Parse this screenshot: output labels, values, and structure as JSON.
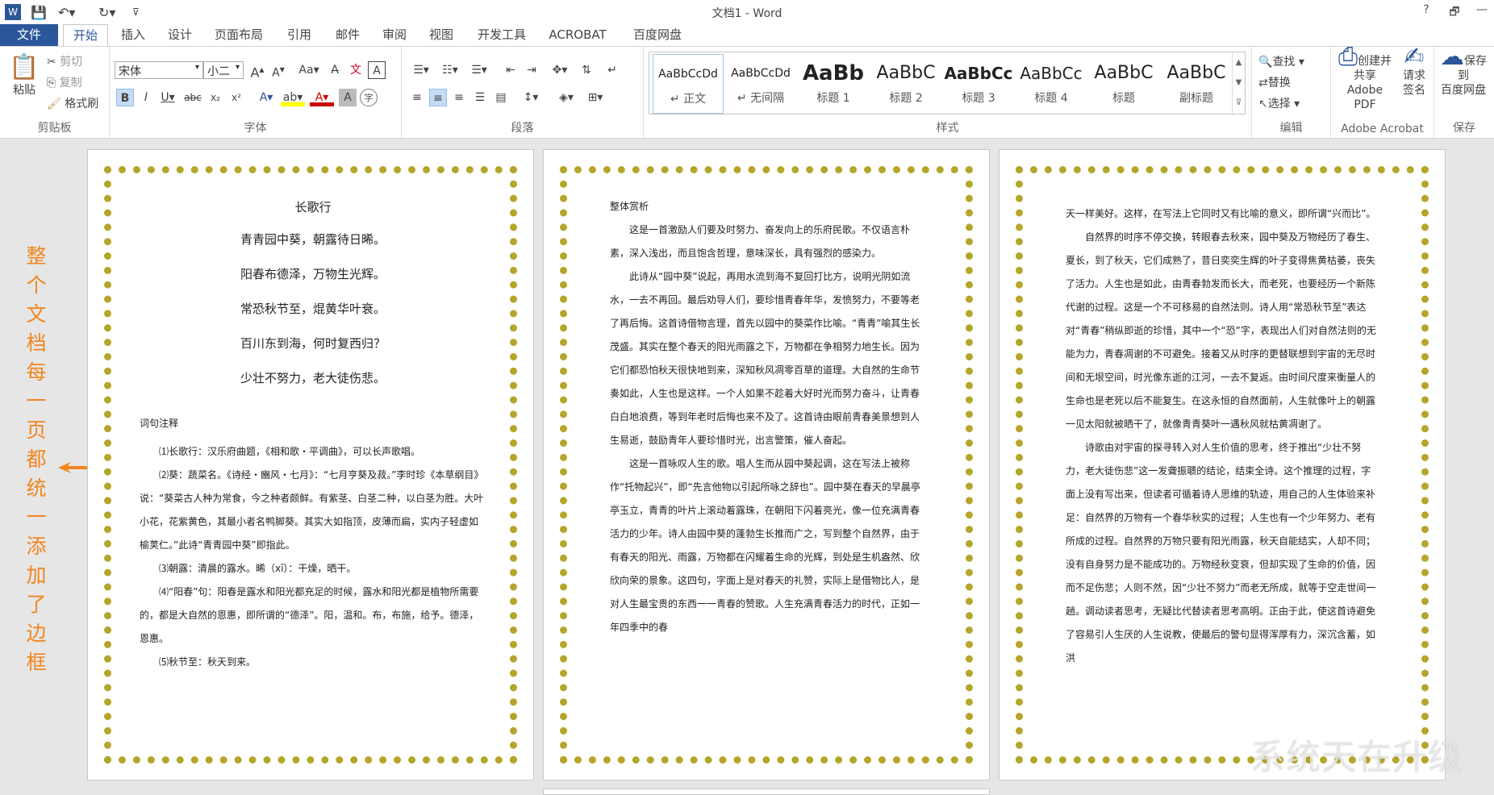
{
  "window": {
    "title": "文档1 - Word",
    "help": "?",
    "restore": "🗗",
    "minimize": "—"
  },
  "tabs": {
    "file": "文件",
    "items": [
      "开始",
      "插入",
      "设计",
      "页面布局",
      "引用",
      "邮件",
      "审阅",
      "视图",
      "开发工具",
      "ACROBAT",
      "百度网盘"
    ]
  },
  "ribbon": {
    "clipboard": {
      "label": "剪贴板",
      "paste": "粘贴",
      "cut": "剪切",
      "copy": "复制",
      "format_painter": "格式刷"
    },
    "font": {
      "label": "字体",
      "name": "宋体",
      "size": "小二"
    },
    "paragraph": {
      "label": "段落"
    },
    "styles": {
      "label": "样式",
      "items": [
        {
          "preview": "AaBbCcDd",
          "name": "↵ 正文"
        },
        {
          "preview": "AaBbCcDd",
          "name": "↵ 无间隔"
        },
        {
          "preview": "AaBb",
          "name": "标题 1"
        },
        {
          "preview": "AaBbC",
          "name": "标题 2"
        },
        {
          "preview": "AaBbCc",
          "name": "标题 3"
        },
        {
          "preview": "AaBbCc",
          "name": "标题 4"
        },
        {
          "preview": "AaBbC",
          "name": "标题"
        },
        {
          "preview": "AaBbC",
          "name": "副标题"
        }
      ]
    },
    "editing": {
      "label": "编辑",
      "find": "查找",
      "replace": "替换",
      "select": "选择"
    },
    "acrobat": {
      "label": "Adobe Acrobat",
      "create": "创建并共享\nAdobe PDF",
      "sign": "请求\n签名"
    },
    "save": {
      "label": "保存",
      "baidu": "保存到\n百度网盘"
    }
  },
  "annotation": "整个文档每一页都统一添加了边框",
  "watermark": "系统天在升级",
  "page1": {
    "title": "长歌行",
    "lines": [
      "青青园中葵，朝露待日晞。",
      "阳春布德泽，万物生光辉。",
      "常恐秋节至，焜黄华叶衰。",
      "百川东到海，何时复西归？",
      "少壮不努力，老大徒伤悲。"
    ],
    "notes_title": "词句注释",
    "notes": [
      "⑴长歌行：汉乐府曲题，《相和歌・平调曲》，可以长声歌唱。",
      "⑵葵：蔬菜名。《诗经・豳风・七月》：“七月亨葵及菽。”李时珍《本草纲目》说：“葵菜古人种为常食，今之种者颇鲜。有紫茎、白茎二种，以白茎为胜。大叶小花，花紫黄色，其最小者名鸭脚葵。其实大如指顶，皮薄而扁，实内子轻虚如榆荚仁。”此诗“青青园中葵”即指此。",
      "⑶朝露：清晨的露水。晞（xī）：干燥，晒干。",
      "⑷“阳春”句：阳春是露水和阳光都充足的时候，露水和阳光都是植物所需要的，都是大自然的恩惠，即所谓的“德泽”。阳，温和。布，布施，给予。德泽，恩惠。",
      "⑸秋节至：秋天到来。"
    ]
  },
  "page2": {
    "title": "整体赏析",
    "paras": [
      "这是一首激励人们要及时努力、奋发向上的乐府民歌。不仅语言朴素，深入浅出，而且饱含哲理，意味深长，具有强烈的感染力。",
      "此诗从“园中葵”说起，再用水流到海不复回打比方，说明光阴如流水，一去不再回。最后劝导人们，要珍惜青春年华，发愤努力，不要等老了再后悔。这首诗借物言理，首先以园中的葵菜作比喻。“青青”喻其生长茂盛。其实在整个春天的阳光雨露之下，万物都在争相努力地生长。因为它们都恐怕秋天很快地到来，深知秋风凋零百草的道理。大自然的生命节奏如此，人生也是这样。一个人如果不趁着大好时光而努力奋斗，让青春白白地浪费，等到年老时后悔也来不及了。这首诗由眼前青春美景想到人生易逝，鼓励青年人要珍惜时光，出言警策，催人奋起。",
      "这是一首咏叹人生的歌。唱人生而从园中葵起调，这在写法上被称作“托物起兴”，即“先言他物以引起所咏之辞也”。园中葵在春天的早晨亭亭玉立，青青的叶片上滚动着露珠，在朝阳下闪着亮光，像一位充满青春活力的少年。诗人由园中葵的蓬勃生长推而广之，写到整个自然界，由于有春天的阳光、雨露，万物都在闪耀着生命的光辉，到处是生机盎然、欣欣向荣的景象。这四句，字面上是对春天的礼赞，实际上是借物比人，是对人生最宝贵的东西一一青春的赞歌。人生充满青春活力的时代，正如一年四季中的春"
    ]
  },
  "page3": {
    "paras": [
      "天一样美好。这样，在写法上它同时又有比喻的意义，即所谓“兴而比”。",
      "自然界的时序不停交换，转眼春去秋来，园中葵及万物经历了春生、夏长，到了秋天，它们成熟了，昔日奕奕生辉的叶子变得焦黄枯萎，丧失了活力。人生也是如此，由青春勃发而长大，而老死，也要经历一个新陈代谢的过程。这是一个不可移易的自然法则。诗人用“常恐秋节至”表达对“青春”稍纵即逝的珍惜，其中一个“恐”字，表现出人们对自然法则的无能为力，青春凋谢的不可避免。接着又从时序的更替联想到宇宙的无尽时间和无垠空间，时光像东逝的江河，一去不复返。由时间尺度来衡量人的生命也是老死以后不能复生。在这永恒的自然面前，人生就像叶上的朝露一见太阳就被晒干了，就像青青葵叶一遇秋风就枯黄凋谢了。",
      "诗歌由对宇宙的探寻转入对人生价值的思考，终于推出“少壮不努力，老大徒伤悲”这一发聋振聩的结论，结束全诗。这个推理的过程，字面上没有写出来，但读者可循着诗人思维的轨迹，用自己的人生体验来补足：自然界的万物有一个春华秋实的过程；人生也有一个少年努力、老有所成的过程。自然界的万物只要有阳光雨露，秋天自能结实，人却不同；没有自身努力是不能成功的。万物经秋变衰，但却实现了生命的价值，因而不足伤悲；人则不然，因“少壮不努力”而老无所成，就等于空走世间一趟。调动读者思考，无疑比代替读者思考高明。正由于此，使这首诗避免了容易引人生厌的人生说教，使最后的警句显得浑厚有力，深沉含蓄，如洪"
    ]
  },
  "colors": {
    "accent": "#2b579a",
    "annotation": "#f2851f",
    "border_star": "#b5a52a"
  }
}
